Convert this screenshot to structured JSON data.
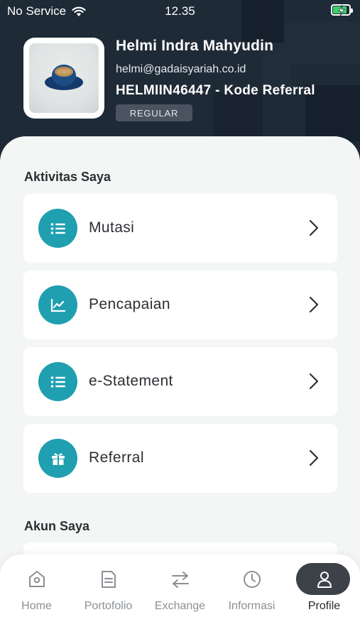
{
  "status_bar": {
    "carrier": "No Service",
    "time": "12.35",
    "battery_color": "#39d26b"
  },
  "profile": {
    "name": "Helmi Indra Mahyudin",
    "email": "helmi@gadaisyariah.co.id",
    "referral": "HELMIIN46447 - Kode Referral",
    "badge": "REGULAR"
  },
  "aktivitas": {
    "title": "Aktivitas Saya",
    "items": [
      {
        "label": "Mutasi",
        "icon": "list-icon"
      },
      {
        "label": "Pencapaian",
        "icon": "chart-icon"
      },
      {
        "label": "e-Statement",
        "icon": "list-icon"
      },
      {
        "label": "Referral",
        "icon": "gift-icon"
      }
    ]
  },
  "akun": {
    "title": "Akun Saya"
  },
  "nav": {
    "items": [
      {
        "label": "Home",
        "icon": "home-icon"
      },
      {
        "label": "Portofolio",
        "icon": "document-icon"
      },
      {
        "label": "Exchange",
        "icon": "exchange-icon"
      },
      {
        "label": "Informasi",
        "icon": "clock-icon"
      },
      {
        "label": "Profile",
        "icon": "user-icon",
        "active": true
      }
    ]
  },
  "colors": {
    "header_bg": "#1f2a37",
    "accent": "#1f9fb0",
    "active_pill": "#3d4148"
  }
}
